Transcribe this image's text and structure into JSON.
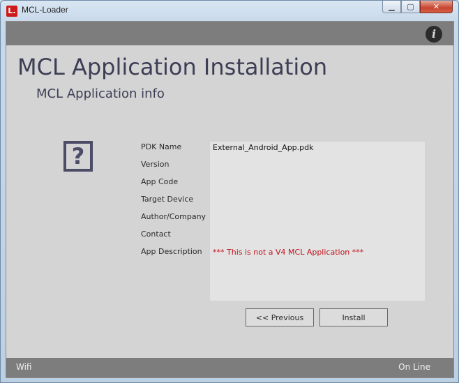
{
  "window": {
    "title": "MCL-Loader",
    "app_icon": "L.",
    "controls": {
      "minimize": "minimize-icon",
      "maximize": "maximize-icon",
      "close": "close-icon"
    }
  },
  "header": {
    "info_icon_glyph": "i",
    "title": "MCL Application Installation",
    "subtitle": "MCL Application info"
  },
  "app_icon_placeholder": "?",
  "fields": [
    {
      "label": "PDK Name",
      "value": "External_Android_App.pdk"
    },
    {
      "label": "Version",
      "value": ""
    },
    {
      "label": "App Code",
      "value": ""
    },
    {
      "label": "Target Device",
      "value": ""
    },
    {
      "label": "Author/Company",
      "value": ""
    },
    {
      "label": "Contact",
      "value": ""
    },
    {
      "label": "App Description",
      "value": "*** This is not a V4 MCL Application ***"
    }
  ],
  "buttons": {
    "previous": "<<  Previous",
    "install": "Install"
  },
  "status": {
    "connection": "Wifi",
    "state": "On Line"
  },
  "colors": {
    "accent_text": "#3d3e55",
    "warning_text": "#c0141c",
    "bar": "#7d7d7d"
  }
}
